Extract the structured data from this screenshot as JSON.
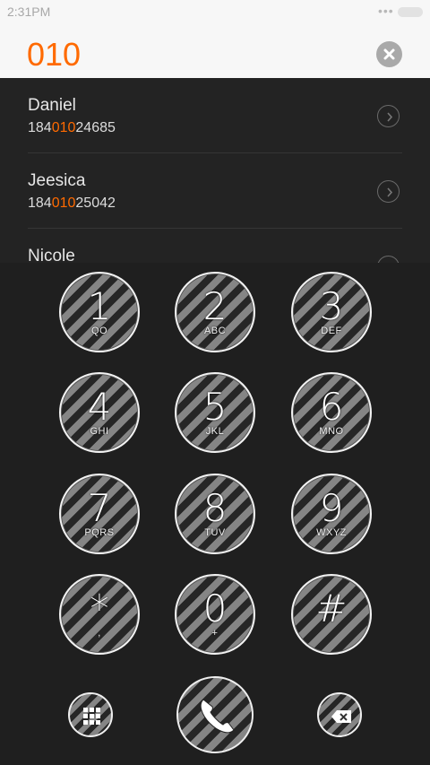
{
  "status_bar": {
    "time": "2:31PM",
    "indicator": "•••"
  },
  "dialer": {
    "dialed_number": "010"
  },
  "contacts": [
    {
      "name": "Daniel",
      "number_prefix": "184",
      "number_match": "010",
      "number_suffix": "24685"
    },
    {
      "name": "Jeesica",
      "number_prefix": "184",
      "number_match": "010",
      "number_suffix": "25042"
    },
    {
      "name": "Nicole"
    }
  ],
  "keypad": {
    "keys": [
      {
        "digit": "1",
        "letters": "QO"
      },
      {
        "digit": "2",
        "letters": "ABC"
      },
      {
        "digit": "3",
        "letters": "DEF"
      },
      {
        "digit": "4",
        "letters": "GHI"
      },
      {
        "digit": "5",
        "letters": "JKL"
      },
      {
        "digit": "6",
        "letters": "MNO"
      },
      {
        "digit": "7",
        "letters": "PQRS"
      },
      {
        "digit": "8",
        "letters": "TUV"
      },
      {
        "digit": "9",
        "letters": "WXYZ"
      },
      {
        "digit": "*",
        "letters": ","
      },
      {
        "digit": "0",
        "letters": "+"
      },
      {
        "digit": "#",
        "letters": ""
      }
    ]
  },
  "icons": {
    "clear": "clear-icon",
    "chevron": "chevron-right-icon",
    "grid": "grid-icon",
    "call": "phone-icon",
    "backspace": "backspace-icon"
  },
  "colors": {
    "accent": "#ff6a00",
    "background": "#232323",
    "header": "#f7f7f7"
  }
}
